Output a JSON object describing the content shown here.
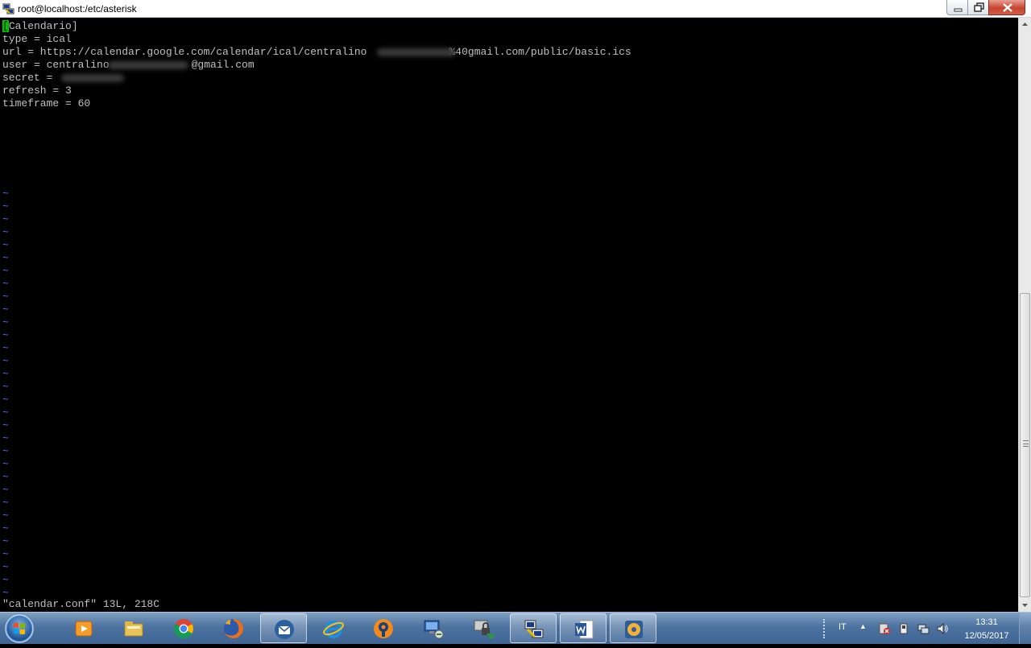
{
  "window": {
    "title": "root@localhost:/etc/asterisk"
  },
  "editor": {
    "lines": [
      {
        "cursor_char": "[",
        "text": "Calendario]"
      },
      {
        "text": "type = ical"
      },
      {
        "text": "url = https://calendar.google.com/calendar/ical/centralino",
        "text2": "%40gmail.com/public/basic.ics"
      },
      {
        "text": "user = centralino",
        "text2": "@gmail.com"
      },
      {
        "text": "secret = "
      },
      {
        "text": "refresh = 3"
      },
      {
        "text": "timeframe = 60"
      }
    ],
    "empty_line_marker": "~",
    "status_line": "\"calendar.conf\" 13L, 218C"
  },
  "taskbar": {
    "language": "IT",
    "clock_time": "13:31",
    "clock_date": "12/05/2017",
    "apps": [
      {
        "name": "media-player-icon"
      },
      {
        "name": "file-explorer-icon"
      },
      {
        "name": "chrome-icon"
      },
      {
        "name": "firefox-icon"
      },
      {
        "name": "thunderbird-icon"
      },
      {
        "name": "internet-explorer-icon"
      },
      {
        "name": "openvpn-icon"
      },
      {
        "name": "remote-connection-icon"
      },
      {
        "name": "vpn-lock-icon"
      },
      {
        "name": "putty-icon"
      },
      {
        "name": "word-icon"
      },
      {
        "name": "media-icon"
      }
    ],
    "active_apps": [
      "putty-icon",
      "word-icon",
      "media-icon"
    ]
  },
  "colors": {
    "terminal_bg": "#000000",
    "terminal_fg": "#c0c0c0",
    "tilde": "#4a6cff",
    "cursor": "#00c000",
    "taskbar": "#4d72a0"
  }
}
